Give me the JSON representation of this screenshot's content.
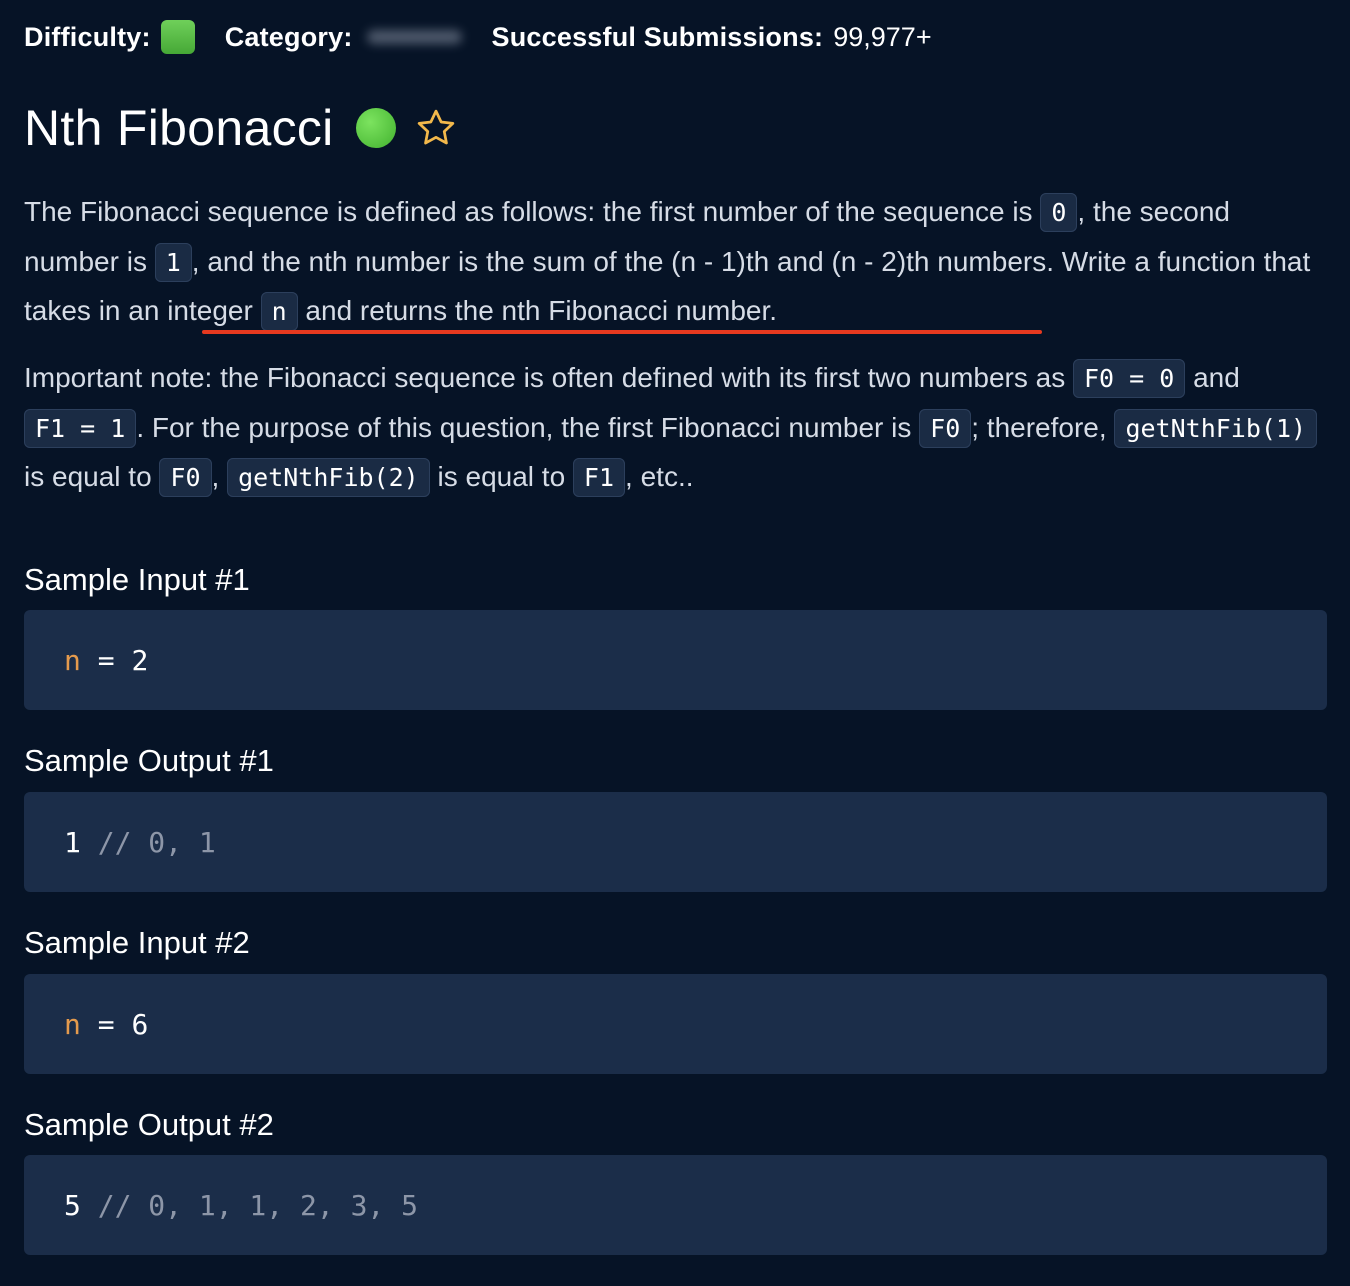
{
  "meta": {
    "difficulty_label": "Difficulty:",
    "category_label": "Category:",
    "submissions_label": "Successful Submissions:",
    "submissions_value": "99,977+",
    "difficulty_color": "#55bb44"
  },
  "title": "Nth Fibonacci",
  "star_icon": "star-outline-icon",
  "description": {
    "p1": {
      "t1": "The Fibonacci sequence is defined as follows: the first number of the sequence is ",
      "c1": "0",
      "t2": ", the second number is ",
      "c2": "1",
      "t3": ", and the nth number is the sum of the (n - 1)th and (n - 2)th numbers. Write a function that ",
      "t4": "takes in an integer ",
      "c3": "n",
      "t5": " and returns the nth Fibonacci number."
    },
    "p2": {
      "t1": "Important note: the Fibonacci sequence is often defined with its first two numbers as ",
      "c1": "F0 = 0",
      "t2": " and ",
      "c2": "F1 = 1",
      "t3": ". For the purpose of this question, the first Fibonacci number is ",
      "c3": "F0",
      "t4": "; therefore, ",
      "c4": "getNthFib(1)",
      "t5": " is equal to ",
      "c5": "F0",
      "t6": ", ",
      "c6": "getNthFib(2)",
      "t7": " is equal to ",
      "c7": "F1",
      "t8": ", etc.."
    }
  },
  "samples": [
    {
      "heading": "Sample Input #1",
      "var": "n",
      "op": " = ",
      "value": "2"
    },
    {
      "heading": "Sample Output #1",
      "value": "1",
      "comment": " // 0, 1"
    },
    {
      "heading": "Sample Input #2",
      "var": "n",
      "op": " = ",
      "value": "6"
    },
    {
      "heading": "Sample Output #2",
      "value": "5",
      "comment": " // 0, 1, 1, 2, 3, 5"
    }
  ]
}
